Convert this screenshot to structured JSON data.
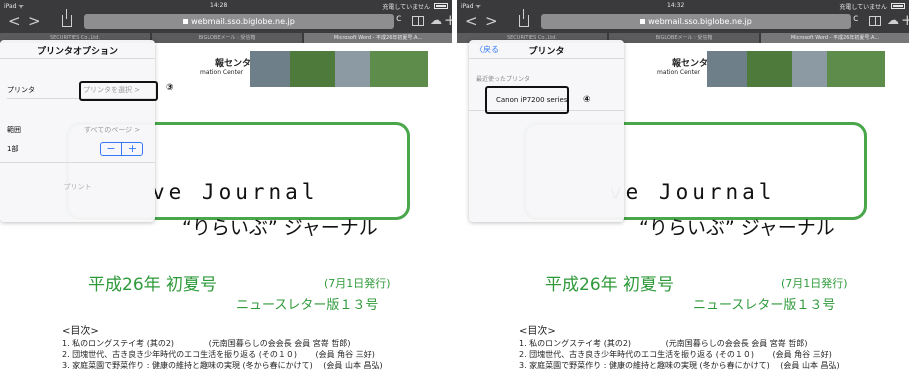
{
  "status": {
    "left": {
      "device": "iPad ᯤ",
      "time": "14:28",
      "charge": "充電していません"
    },
    "right": {
      "device": "iPad ᯤ",
      "time": "14:32",
      "charge": "充電していません"
    }
  },
  "url": "webmail.sso.biglobe.ne.jp",
  "tabs": [
    "SECURITIES Co.,Ltd.",
    "BIGLOBEメール : 受信箱",
    "Microsoft Word - 平成26年初夏号.A..."
  ],
  "doc": {
    "header": "報センター",
    "header_sub": "mation Center",
    "title": "ve Journal",
    "subtitle": "“りらいぶ” ジャーナル",
    "year": "平成26年 初夏号",
    "date": "(7月1日発行)",
    "newsletter": "ニュースレター版１３号",
    "toc_head": "<目次>",
    "toc": [
      "1. 私のロングステイ考 (其の2)　　　　 (元南国暮らしの会会長 会員 宮嵜 哲郎)",
      "2. 団塊世代、古き良き少年時代のエコ生活を振り返る (その１０)　　 (会員 角谷 三好)",
      "3. 家庭菜園で野菜作り : 健康の維持と趣味の実現 (冬から春にかけて)　 (会員 山本 昌弘)"
    ]
  },
  "left_popover": {
    "title": "プリンタオプション",
    "printer_label": "プリンタ",
    "printer_value": "プリンタを選択 >",
    "range_label": "範囲",
    "range_value": "すべてのページ >",
    "copies_label": "1部",
    "minus": "−",
    "plus": "+",
    "print": "プリント",
    "callout": "③"
  },
  "right_popover": {
    "back": "〈戻る",
    "title": "プリンタ",
    "recent_label": "最近使ったプリンタ",
    "printer_name": "Canon iP7200 series",
    "callout": "④"
  },
  "colors": {
    "accent": "#3478f6",
    "green": "#2f9a3a",
    "chrome": "#3a3a3c"
  }
}
